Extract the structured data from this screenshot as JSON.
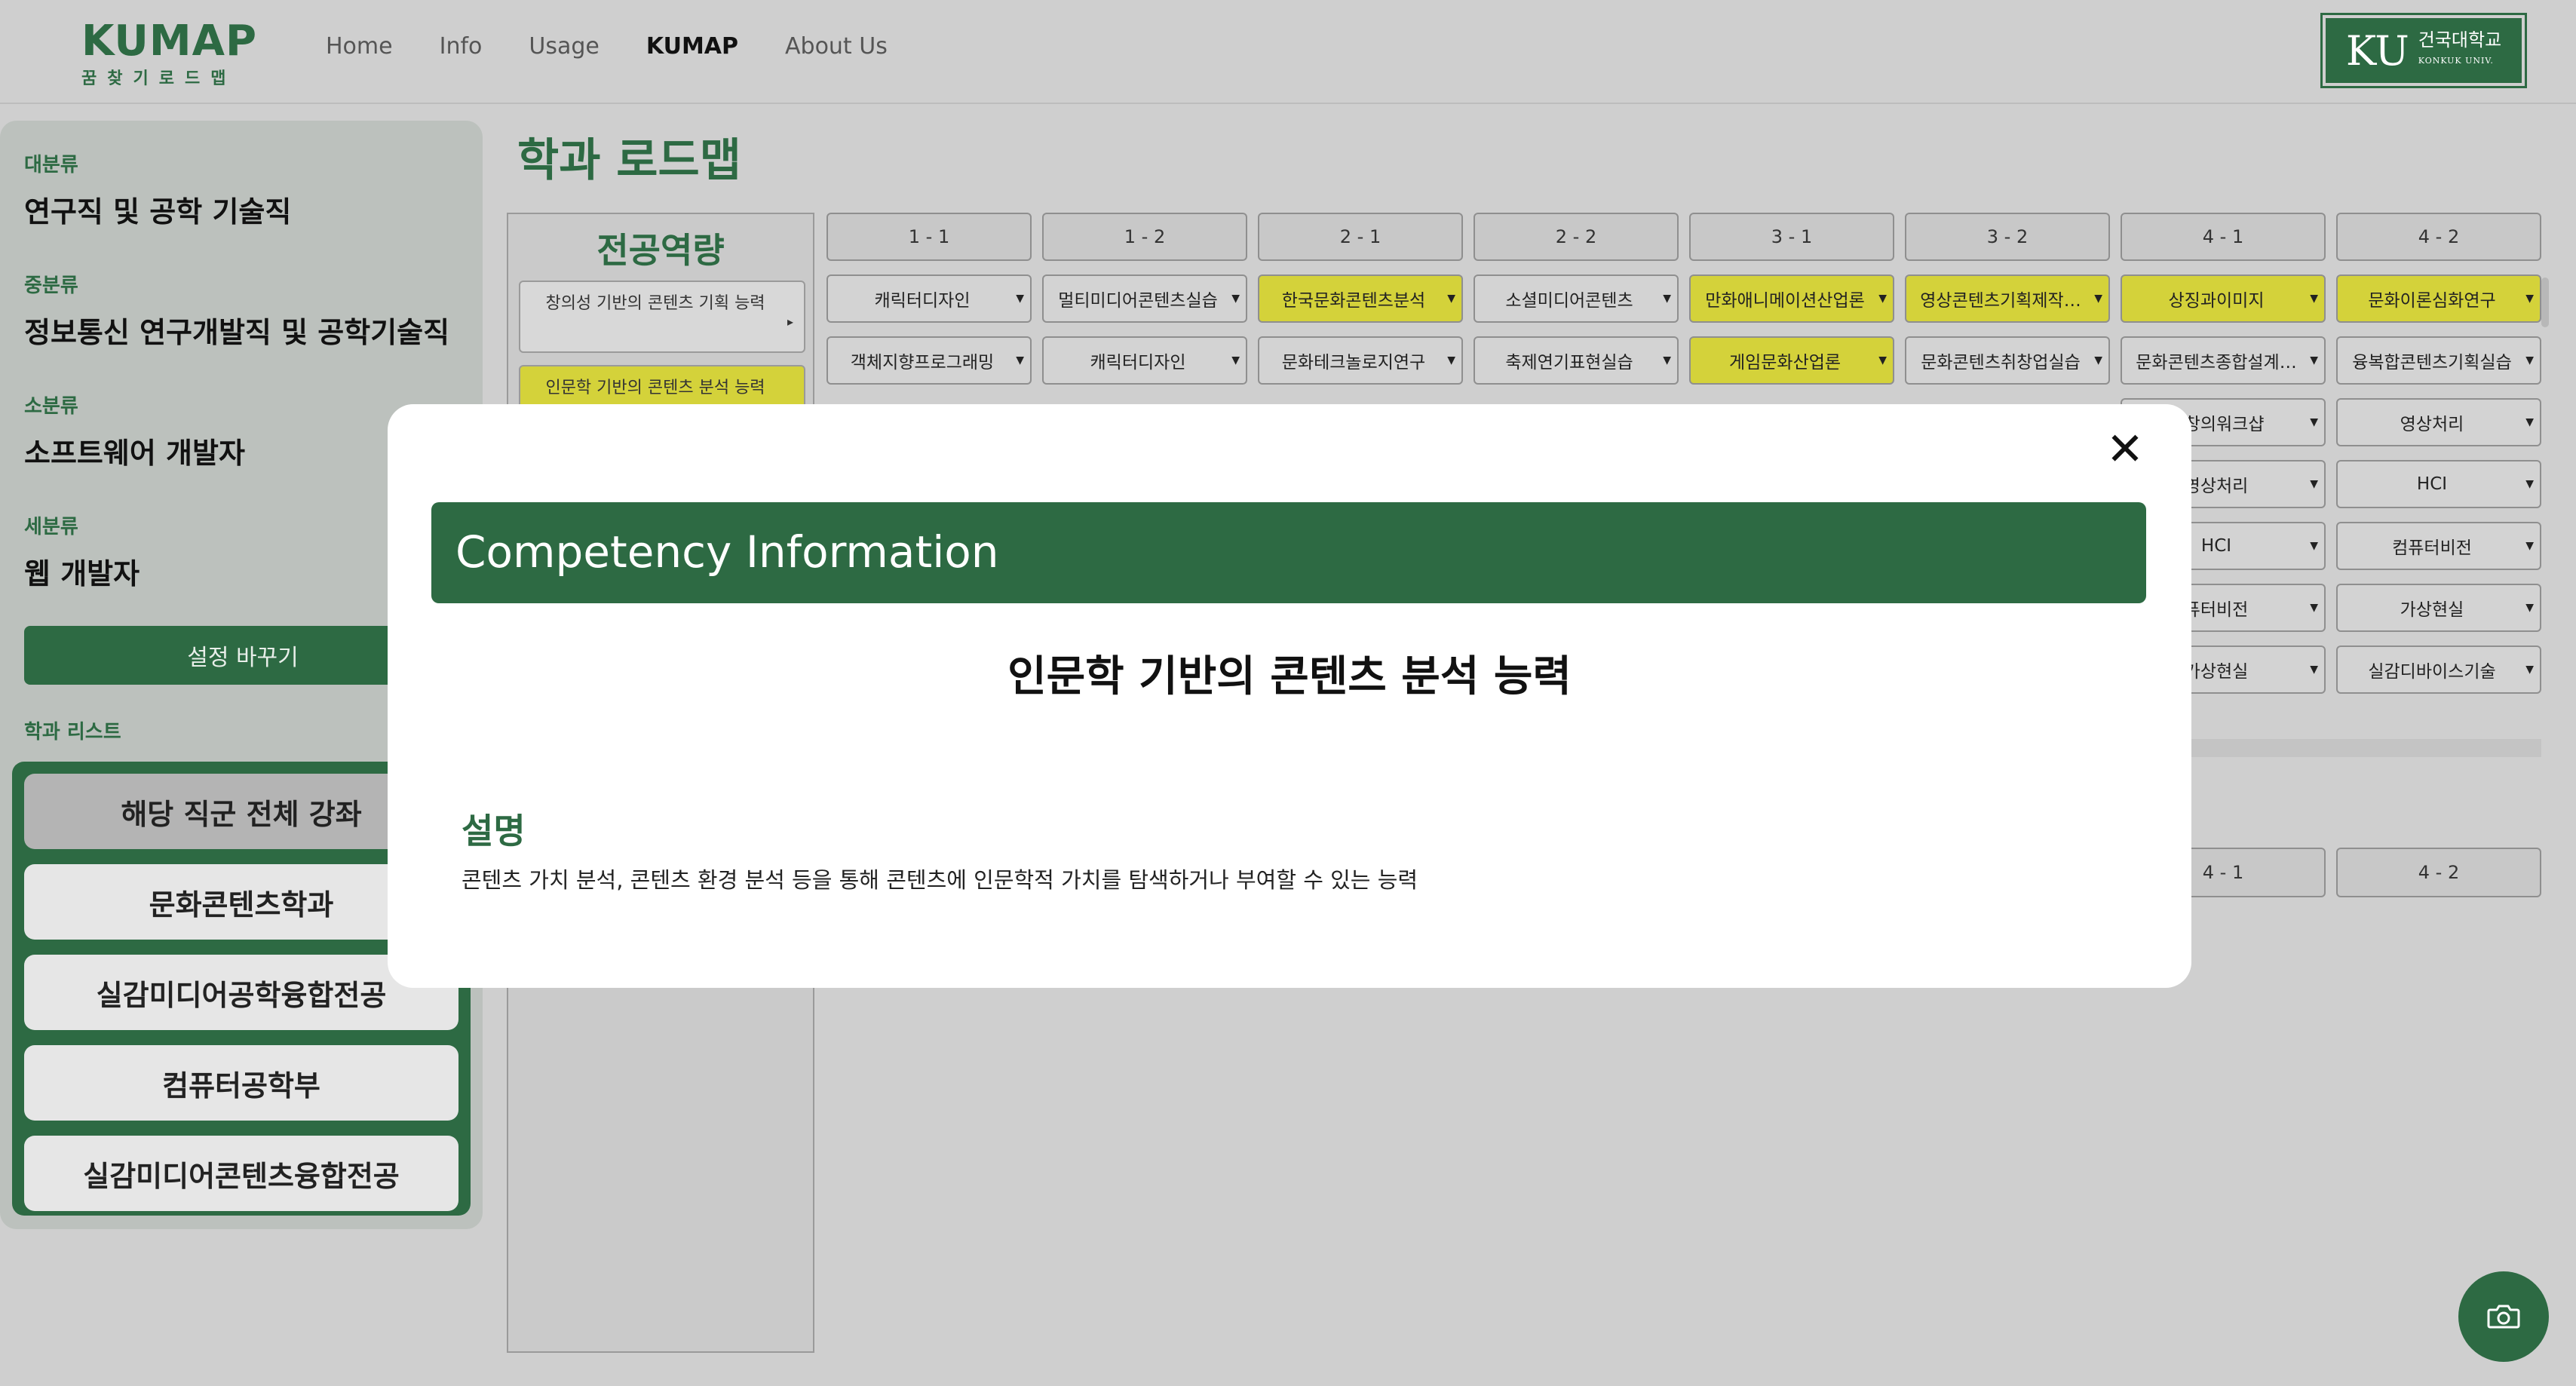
{
  "header": {
    "logo_title": "KUMAP",
    "logo_subtitle": "꿈찾기로드맵",
    "nav": [
      "Home",
      "Info",
      "Usage",
      "KUMAP",
      "About Us"
    ],
    "active_nav": "KUMAP",
    "university_logo": {
      "mark": "KU",
      "name_ko": "건국대학교",
      "name_en": "KONKUK UNIV."
    }
  },
  "sidebar": {
    "major_label": "대분류",
    "major_value": "연구직 및 공학 기술직",
    "middle_label": "중분류",
    "middle_value": "정보통신 연구개발직 및 공학기술직",
    "minor_label": "소분류",
    "minor_value": "소프트웨어 개발자",
    "detail_label": "세분류",
    "detail_value": "웹 개발자",
    "settings_button": "설정 바꾸기",
    "dept_list_label": "학과 리스트",
    "departments": [
      "해당 직군 전체 강좌",
      "문화콘텐츠학과",
      "실감미디어공학융합전공",
      "컴퓨터공학부",
      "실감미디어콘텐츠융합전공"
    ]
  },
  "main": {
    "title": "학과 로드맵",
    "competency_header": "전공역량",
    "competencies": [
      "창의성 기반의 콘텐츠 기획 능력",
      "인문학 기반의 콘텐츠 분석 능력"
    ],
    "semesters": [
      "1 - 1",
      "1 - 2",
      "2 - 1",
      "2 - 2",
      "3 - 1",
      "3 - 2",
      "4 - 1",
      "4 - 2"
    ],
    "course_rows": [
      [
        "캐릭터디자인",
        "멀티미디어콘텐츠실습",
        "한국문화콘텐츠분석",
        "소셜미디어콘텐츠",
        "만화애니메이션산업론",
        "영상콘텐츠기획제작…",
        "상징과이미지",
        "문화이론심화연구"
      ],
      [
        "객체지향프로그래밍",
        "캐릭터디자인",
        "문화테크놀로지연구",
        "축제연기표현실습",
        "게임문화산업론",
        "문화콘텐츠취창업실습",
        "문화콘텐츠종합설계…",
        "융복합콘텐츠기획실습"
      ]
    ],
    "right_column_rows": [
      [
        "력창의워크샵",
        "영상처리"
      ],
      [
        "영상처리",
        "HCI"
      ],
      [
        "HCI",
        "컴퓨터비전"
      ],
      [
        "퓨터비전",
        "가상현실"
      ],
      [
        "가상현실",
        "실감디바이스기술"
      ]
    ],
    "lower_semesters": [
      "4 - 1",
      "4 - 2"
    ]
  },
  "modal": {
    "header": "Competency Information",
    "title": "인문학 기반의 콘텐츠 분석 능력",
    "description_label": "설명",
    "description": "콘텐츠 가치 분석, 콘텐츠 환경 분석 등을 통해 콘텐츠에 인문학적 가치를 탐색하거나 부여할 수 있는 능력"
  },
  "colors": {
    "brand_green": "#2d6a43",
    "highlight_yellow": "#d4d23a",
    "dim_background": "#cfcfcf"
  },
  "icons": {
    "close": "close-icon",
    "camera": "camera-icon",
    "dropdown": "caret-down-icon"
  }
}
